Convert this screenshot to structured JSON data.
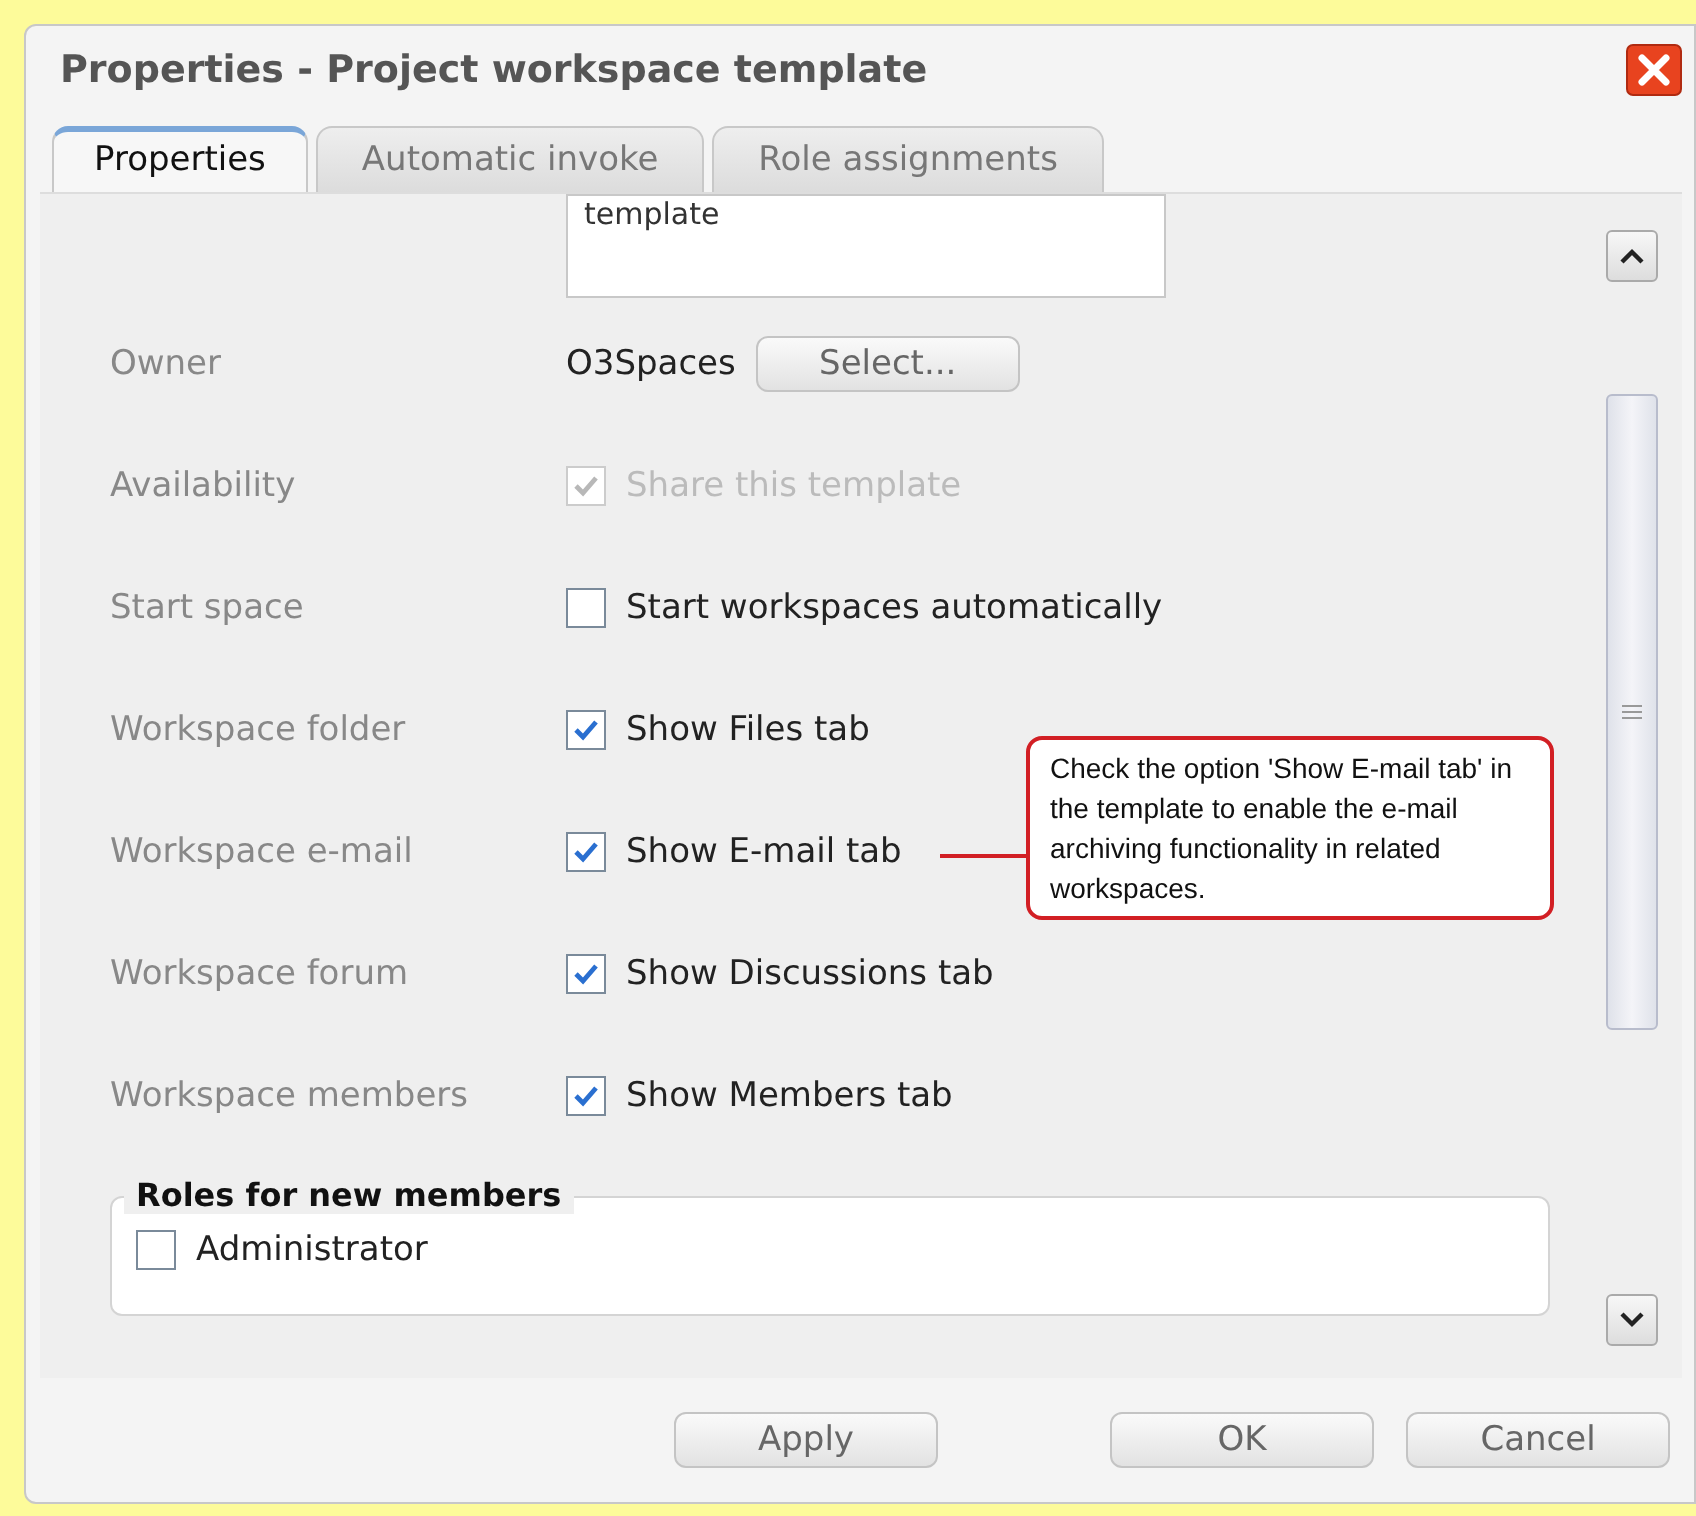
{
  "window": {
    "title": "Properties - Project workspace template"
  },
  "tabs": [
    {
      "label": "Properties",
      "selected": true
    },
    {
      "label": "Automatic invoke",
      "selected": false
    },
    {
      "label": "Role assignments",
      "selected": false
    }
  ],
  "description": {
    "value": "template"
  },
  "owner": {
    "label": "Owner",
    "value": "O3Spaces",
    "button": "Select..."
  },
  "options": [
    {
      "label": "Availability",
      "option": "Share this template",
      "checked": true,
      "disabled": true
    },
    {
      "label": "Start space",
      "option": "Start workspaces automatically",
      "checked": false,
      "disabled": false
    },
    {
      "label": "Workspace folder",
      "option": "Show Files tab",
      "checked": true,
      "disabled": false
    },
    {
      "label": "Workspace e-mail",
      "option": "Show E-mail tab",
      "checked": true,
      "disabled": false,
      "callout": "Check the option 'Show E-mail tab' in the template to enable the e-mail archiving functionality in related workspaces."
    },
    {
      "label": "Workspace forum",
      "option": "Show Discussions tab",
      "checked": true,
      "disabled": false
    },
    {
      "label": "Workspace members",
      "option": "Show Members tab",
      "checked": true,
      "disabled": false
    }
  ],
  "roles": {
    "title": "Roles for new members",
    "items": [
      {
        "label": "Administrator",
        "checked": false
      }
    ]
  },
  "buttons": [
    {
      "label": "Apply"
    },
    {
      "label": "OK"
    },
    {
      "label": "Cancel"
    }
  ]
}
